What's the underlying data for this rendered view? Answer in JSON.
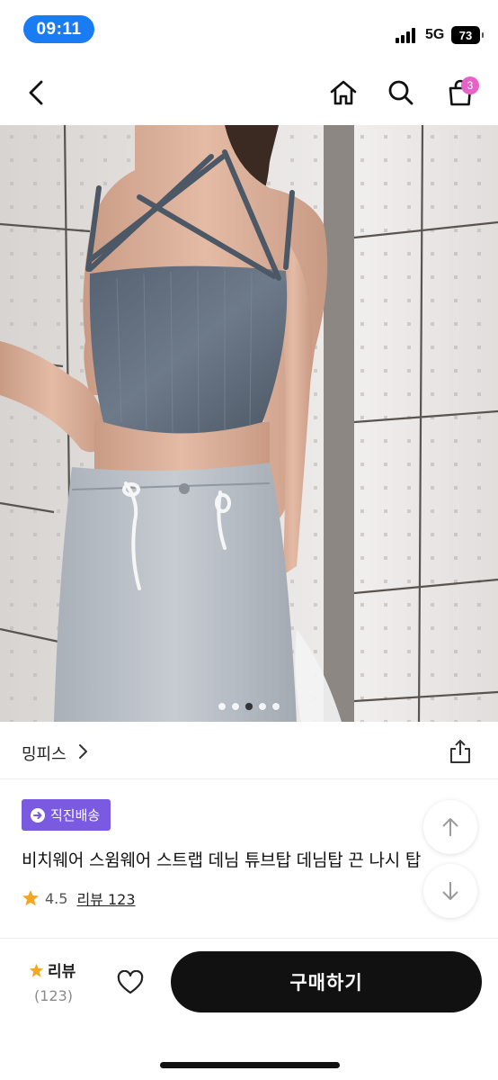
{
  "status_bar": {
    "time": "09:11",
    "network": "5G",
    "battery": "73"
  },
  "header": {
    "cart_count": "3"
  },
  "carousel": {
    "total": 5,
    "active_index": 2
  },
  "brand": {
    "name": "밍피스"
  },
  "product": {
    "badge_label": "직진배송",
    "title": "비치웨어 스윔웨어 스트랩 데님 튜브탑 데님탑 끈 나시 탑",
    "rating": "4.5",
    "review_link": "리뷰 123"
  },
  "bottom_bar": {
    "review_label": "리뷰",
    "review_count": "(123)",
    "buy_label": "구매하기"
  },
  "colors": {
    "badge": "#7a5ae0",
    "cart_badge": "#e661c8",
    "star": "#f5a623",
    "time_pill": "#1a7cf3"
  },
  "icons": [
    "back-icon",
    "home-icon",
    "search-icon",
    "cart-icon",
    "chevron-right-icon",
    "share-icon",
    "direct-delivery-icon",
    "star-icon",
    "arrow-up-icon",
    "arrow-down-icon",
    "heart-icon"
  ]
}
